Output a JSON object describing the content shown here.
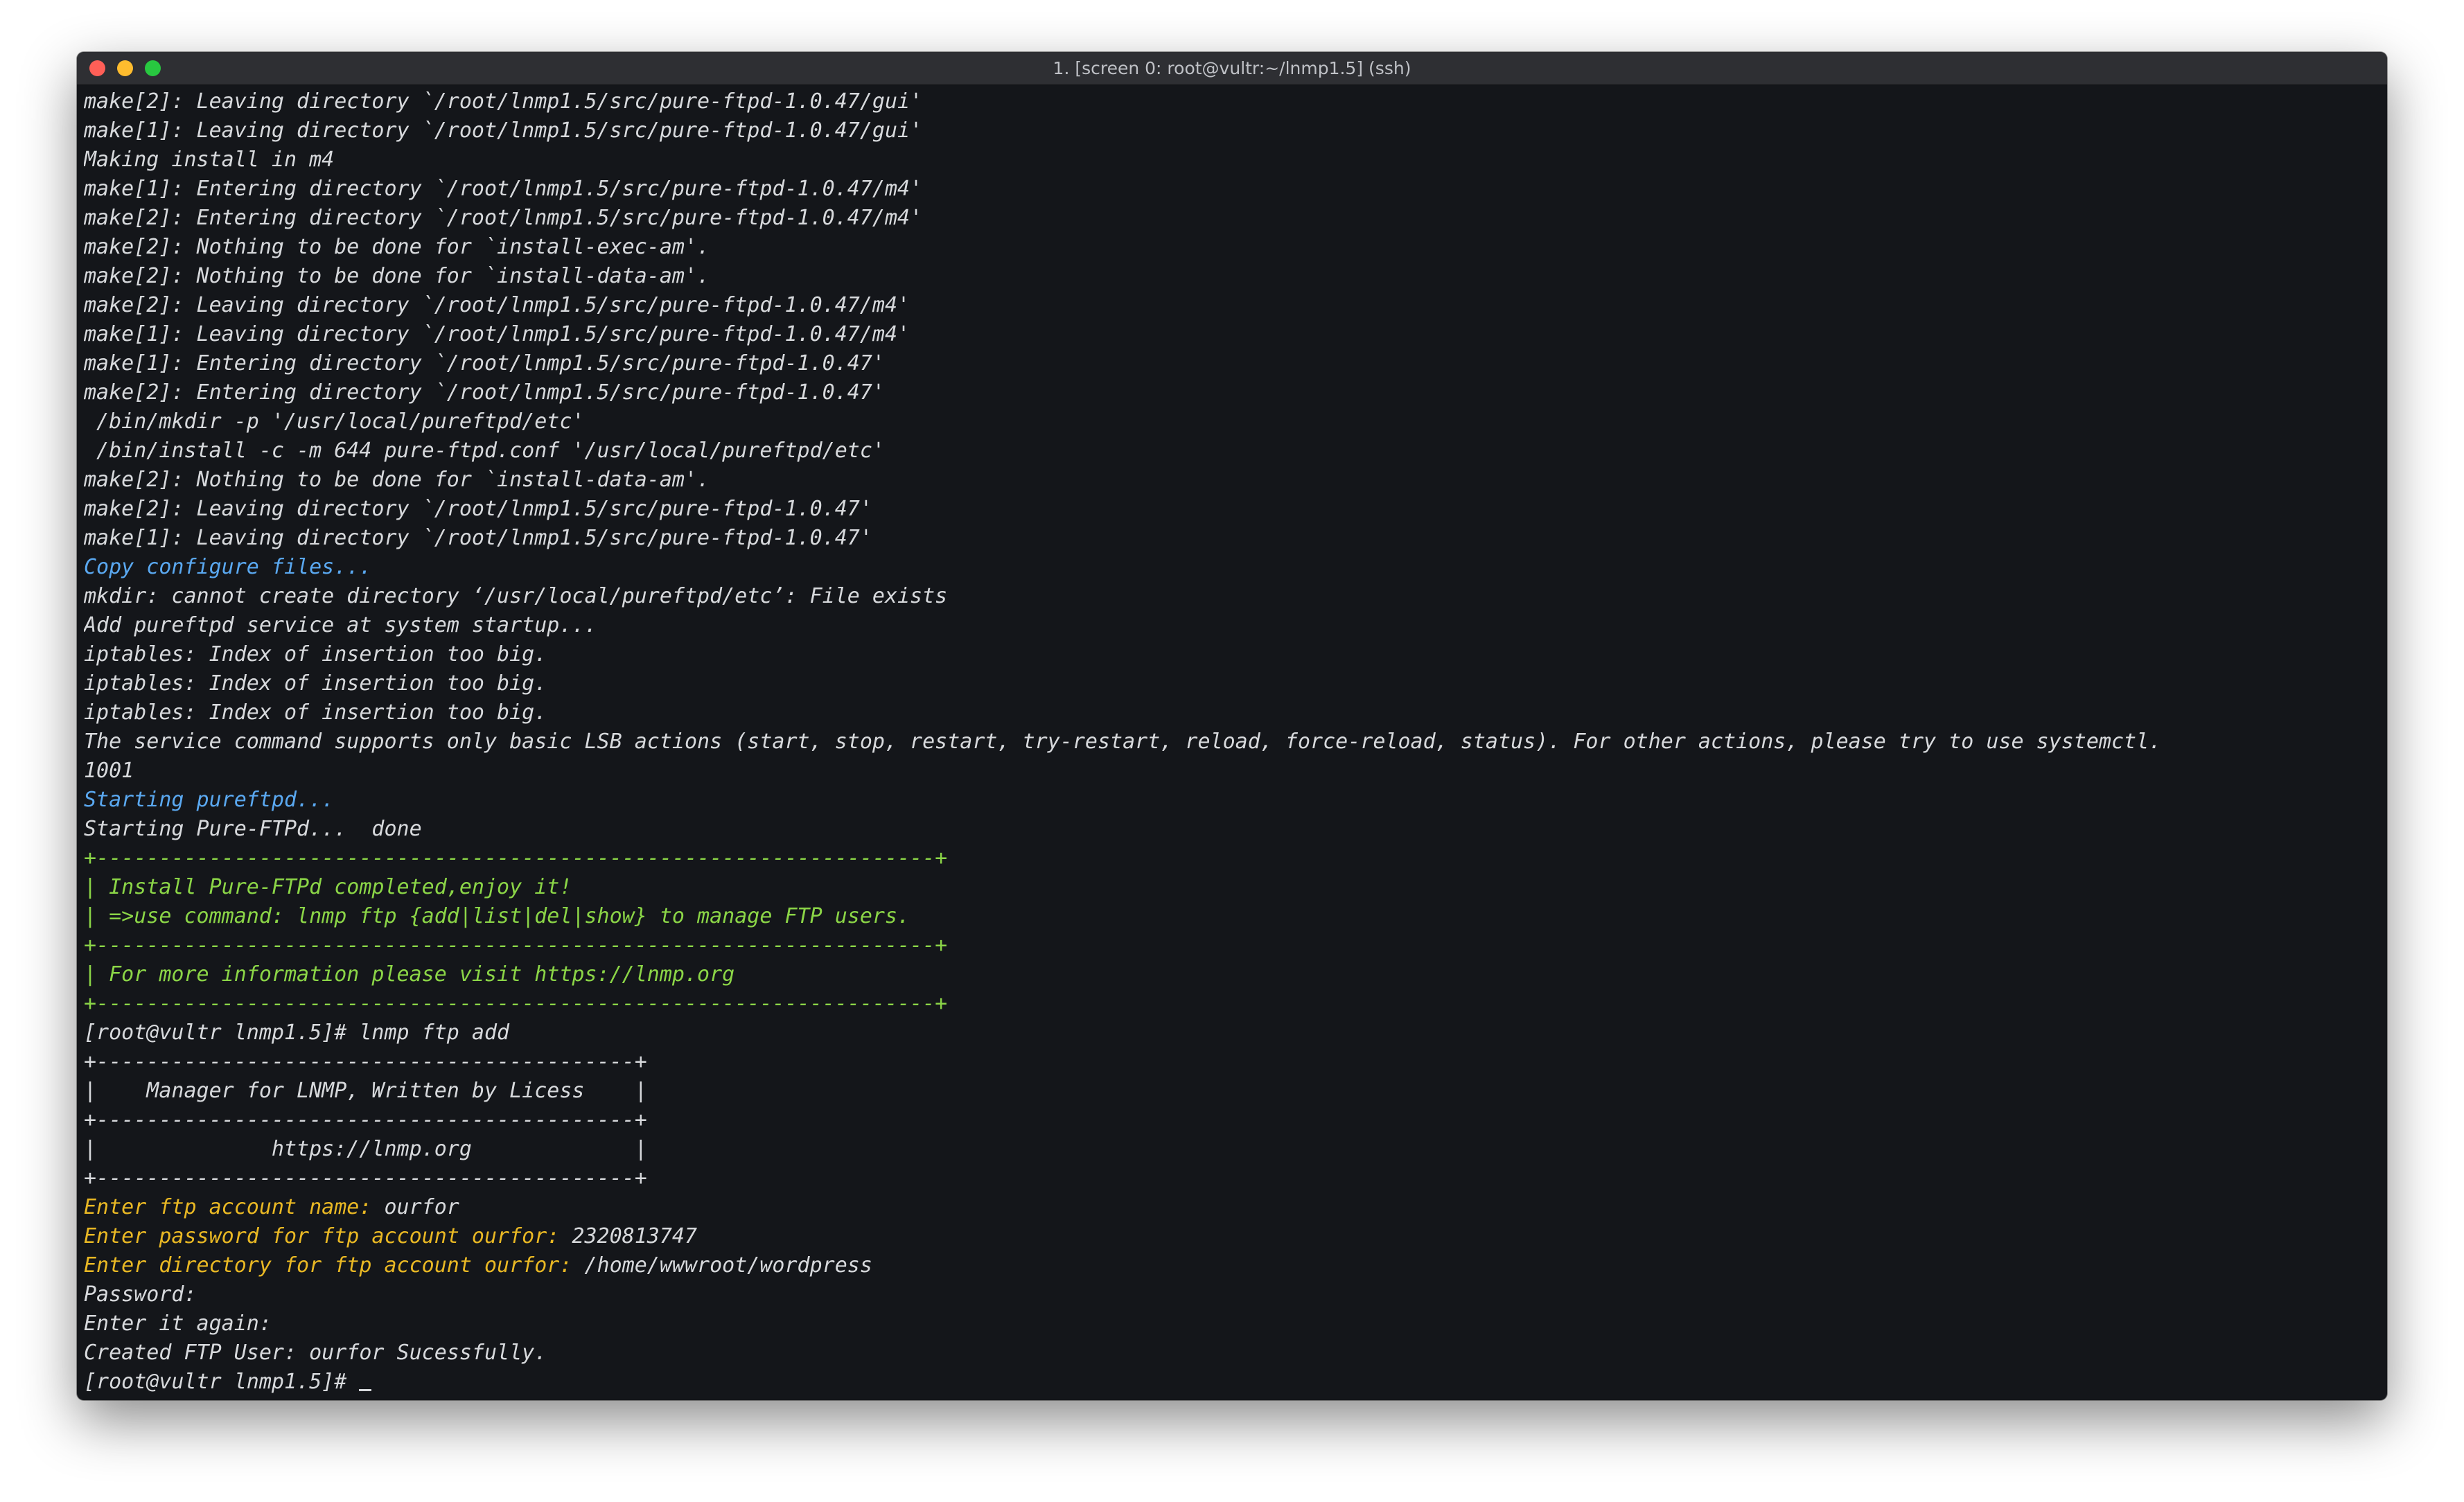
{
  "window": {
    "title": "1. [screen 0: root@vultr:~/lnmp1.5] (ssh)",
    "traffic_lights": {
      "close_color": "#ff5f57",
      "minimize_color": "#febc2e",
      "zoom_color": "#28c840"
    }
  },
  "colors": {
    "default": "#d7d9dc",
    "blue": "#5aa8f0",
    "green": "#8bd547",
    "yellow": "#e9b824",
    "background": "#14161a"
  },
  "terminal": {
    "lines": [
      {
        "text": "make[2]: Leaving directory `/root/lnmp1.5/src/pure-ftpd-1.0.47/gui'",
        "color": "default"
      },
      {
        "text": "make[1]: Leaving directory `/root/lnmp1.5/src/pure-ftpd-1.0.47/gui'",
        "color": "default"
      },
      {
        "text": "Making install in m4",
        "color": "default"
      },
      {
        "text": "make[1]: Entering directory `/root/lnmp1.5/src/pure-ftpd-1.0.47/m4'",
        "color": "default"
      },
      {
        "text": "make[2]: Entering directory `/root/lnmp1.5/src/pure-ftpd-1.0.47/m4'",
        "color": "default"
      },
      {
        "text": "make[2]: Nothing to be done for `install-exec-am'.",
        "color": "default"
      },
      {
        "text": "make[2]: Nothing to be done for `install-data-am'.",
        "color": "default"
      },
      {
        "text": "make[2]: Leaving directory `/root/lnmp1.5/src/pure-ftpd-1.0.47/m4'",
        "color": "default"
      },
      {
        "text": "make[1]: Leaving directory `/root/lnmp1.5/src/pure-ftpd-1.0.47/m4'",
        "color": "default"
      },
      {
        "text": "make[1]: Entering directory `/root/lnmp1.5/src/pure-ftpd-1.0.47'",
        "color": "default"
      },
      {
        "text": "make[2]: Entering directory `/root/lnmp1.5/src/pure-ftpd-1.0.47'",
        "color": "default"
      },
      {
        "text": " /bin/mkdir -p '/usr/local/pureftpd/etc'",
        "color": "default"
      },
      {
        "text": " /bin/install -c -m 644 pure-ftpd.conf '/usr/local/pureftpd/etc'",
        "color": "default"
      },
      {
        "text": "make[2]: Nothing to be done for `install-data-am'.",
        "color": "default"
      },
      {
        "text": "make[2]: Leaving directory `/root/lnmp1.5/src/pure-ftpd-1.0.47'",
        "color": "default"
      },
      {
        "text": "make[1]: Leaving directory `/root/lnmp1.5/src/pure-ftpd-1.0.47'",
        "color": "default"
      },
      {
        "text": "Copy configure files...",
        "color": "blue"
      },
      {
        "text": "mkdir: cannot create directory ‘/usr/local/pureftpd/etc’: File exists",
        "color": "default"
      },
      {
        "text": "Add pureftpd service at system startup...",
        "color": "default"
      },
      {
        "text": "iptables: Index of insertion too big.",
        "color": "default"
      },
      {
        "text": "iptables: Index of insertion too big.",
        "color": "default"
      },
      {
        "text": "iptables: Index of insertion too big.",
        "color": "default"
      },
      {
        "text": "The service command supports only basic LSB actions (start, stop, restart, try-restart, reload, force-reload, status). For other actions, please try to use systemctl.",
        "color": "default"
      },
      {
        "text": "1001",
        "color": "default"
      },
      {
        "text": "Starting pureftpd...",
        "color": "blue"
      },
      {
        "text": "Starting Pure-FTPd...  done",
        "color": "default"
      },
      {
        "text": "+-------------------------------------------------------------------+",
        "color": "green"
      },
      {
        "text": "| Install Pure-FTPd completed,enjoy it!",
        "color": "green"
      },
      {
        "text": "| =>use command: lnmp ftp {add|list|del|show} to manage FTP users.",
        "color": "green"
      },
      {
        "text": "+-------------------------------------------------------------------+",
        "color": "green"
      },
      {
        "text": "| For more information please visit https://lnmp.org",
        "color": "green"
      },
      {
        "text": "+-------------------------------------------------------------------+",
        "color": "green"
      },
      {
        "text": "[root@vultr lnmp1.5]# lnmp ftp add",
        "color": "default"
      },
      {
        "text": "+-------------------------------------------+",
        "color": "default"
      },
      {
        "text": "|    Manager for LNMP, Written by Licess    |",
        "color": "default"
      },
      {
        "text": "+-------------------------------------------+",
        "color": "default"
      },
      {
        "text": "|              https://lnmp.org             |",
        "color": "default"
      },
      {
        "text": "+-------------------------------------------+",
        "color": "default"
      },
      {
        "prompt": "Enter ftp account name: ",
        "value": "ourfor"
      },
      {
        "prompt": "Enter password for ftp account ourfor: ",
        "value": "2320813747"
      },
      {
        "prompt": "Enter directory for ftp account ourfor: ",
        "value": "/home/wwwroot/wordpress"
      },
      {
        "text": "Password:",
        "color": "default"
      },
      {
        "text": "Enter it again:",
        "color": "default"
      },
      {
        "text": "Created FTP User: ourfor Sucessfully.",
        "color": "default"
      },
      {
        "text": "[root@vultr lnmp1.5]# ",
        "color": "default",
        "cursor": true
      }
    ]
  }
}
